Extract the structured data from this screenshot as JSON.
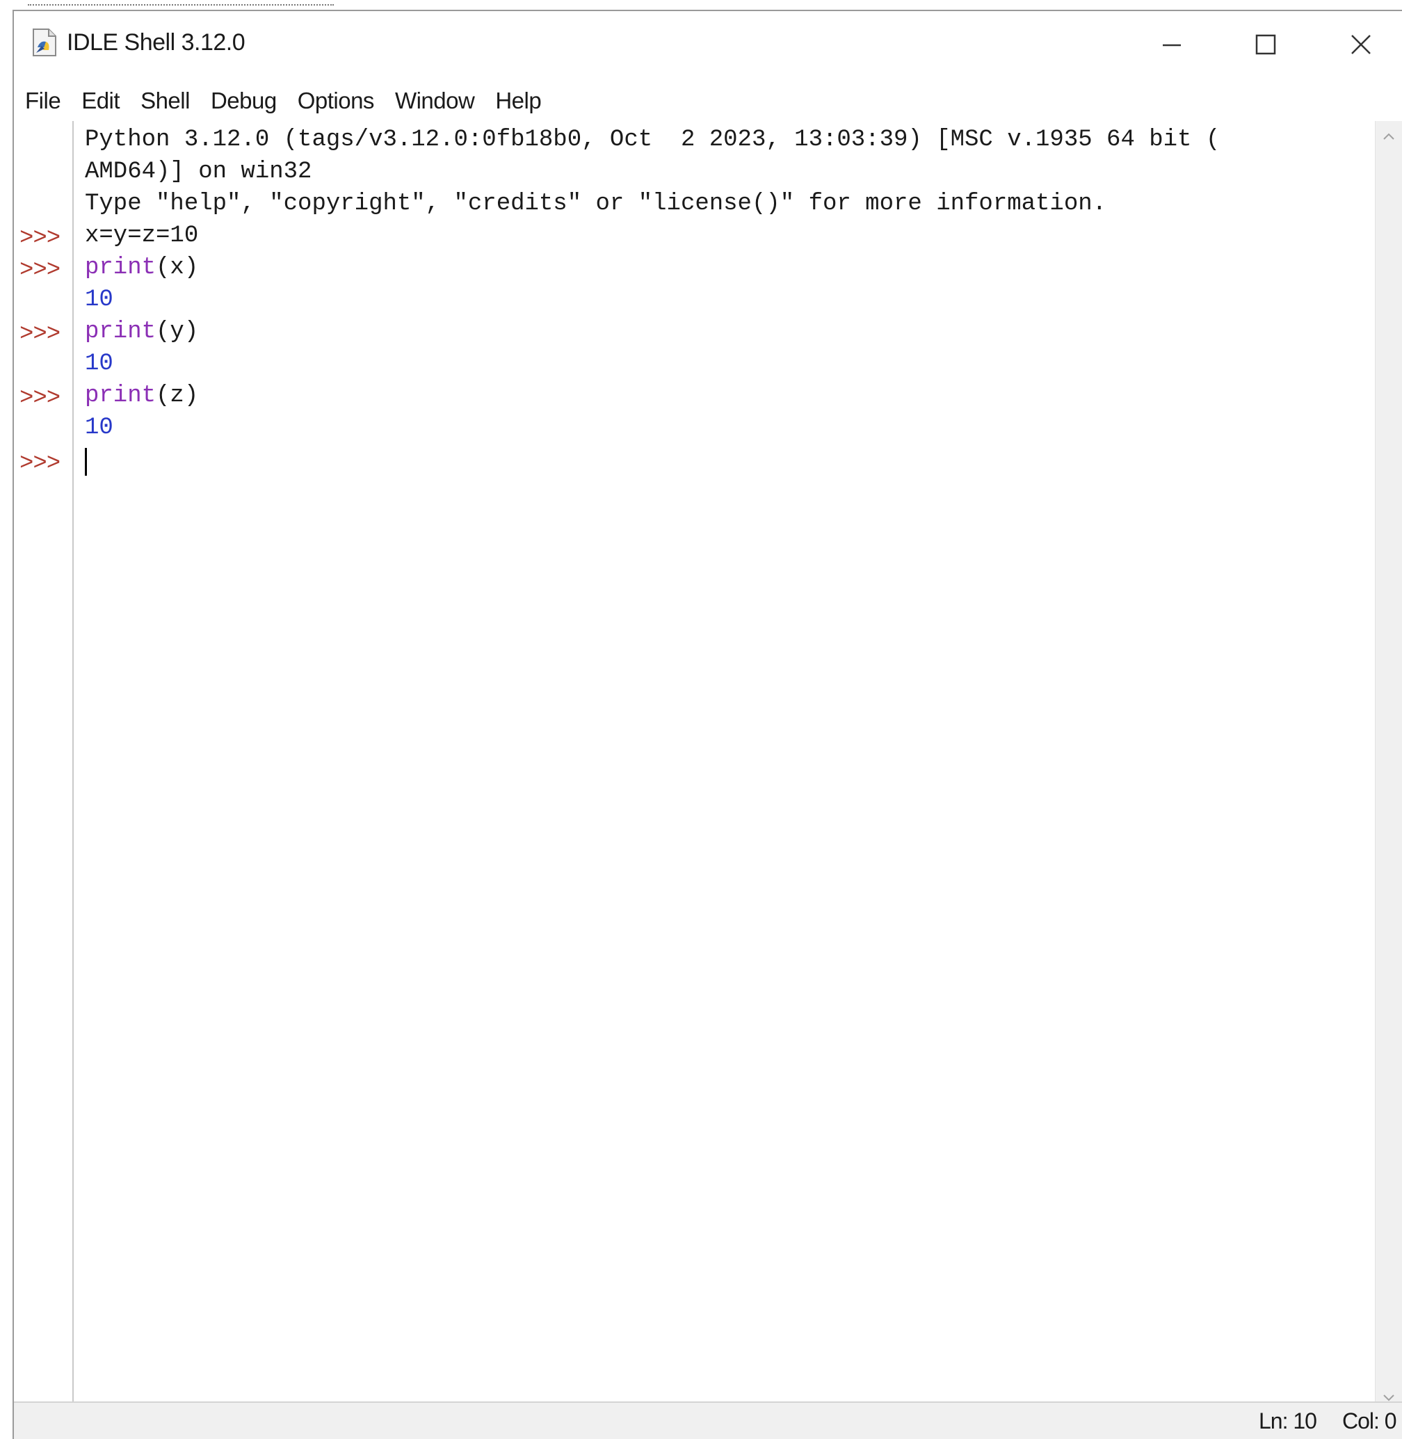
{
  "window": {
    "title": "IDLE Shell 3.12.0",
    "icon": "python-idle-icon"
  },
  "title_controls": {
    "minimize_icon": "minimize-icon",
    "maximize_icon": "maximize-icon",
    "close_icon": "close-icon"
  },
  "menubar": {
    "items": [
      "File",
      "Edit",
      "Shell",
      "Debug",
      "Options",
      "Window",
      "Help"
    ]
  },
  "shell": {
    "banner_line1": "Python 3.12.0 (tags/v3.12.0:0fb18b0, Oct  2 2023, 13:03:39) [MSC v.1935 64 bit (",
    "banner_line2": "AMD64)] on win32",
    "banner_line3": "Type \"help\", \"copyright\", \"credits\" or \"license()\" for more information.",
    "prompt": ">>>",
    "cmd1": "x=y=z=10",
    "cmd2_kw": "print",
    "cmd2_args": "(x)",
    "out2": "10",
    "cmd3_kw": "print",
    "cmd3_args": "(y)",
    "out3": "10",
    "cmd4_kw": "print",
    "cmd4_args": "(z)",
    "out4": "10"
  },
  "statusbar": {
    "line": "Ln: 10",
    "col": "Col: 0"
  },
  "colors": {
    "prompt": "#b03a2e",
    "keyword": "#8b2fb5",
    "output": "#2738c9",
    "text": "#1a1a1a"
  }
}
